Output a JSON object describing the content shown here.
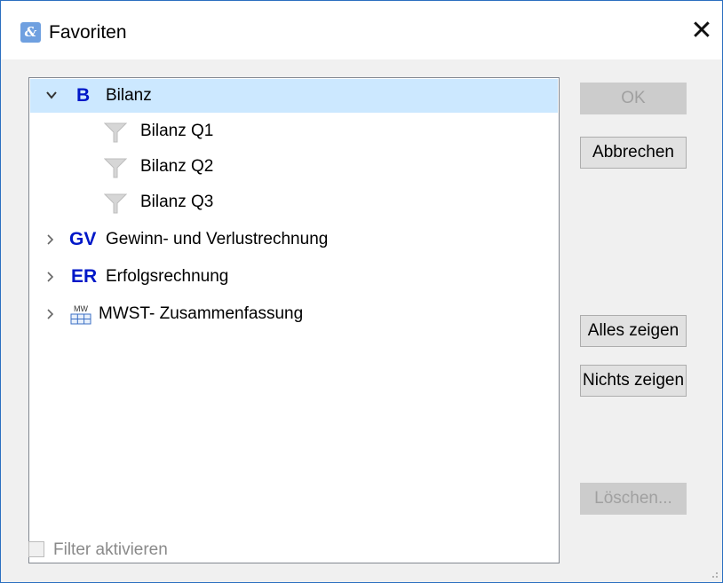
{
  "window": {
    "title": "Favoriten",
    "icon": "app-logo-icon",
    "close_glyph": "✕"
  },
  "tree": {
    "nodes": [
      {
        "abbr": "B",
        "label": "Bilanz",
        "expanded": true,
        "selected": true
      },
      {
        "label": "Bilanz Q1",
        "icon": "filter-funnel-icon"
      },
      {
        "label": "Bilanz Q2",
        "icon": "filter-funnel-icon"
      },
      {
        "label": "Bilanz Q3",
        "icon": "filter-funnel-icon"
      },
      {
        "abbr": "GV",
        "label": "Gewinn- und Verlustrechnung",
        "expanded": false
      },
      {
        "abbr": "ER",
        "label": "Erfolgsrechnung",
        "expanded": false
      },
      {
        "label": "MWST- Zusammenfassung",
        "icon": "mw-table-icon",
        "icon_text": "MW",
        "expanded": false
      }
    ],
    "collapse_glyph": "⌄",
    "expand_glyph": "›",
    "selected_color": "#cce8ff",
    "abbr_color": "#0018c8"
  },
  "buttons": {
    "ok": "OK",
    "cancel": "Abbrechen",
    "show_all": "Alles zeigen",
    "show_none": "Nichts zeigen",
    "delete": "Löschen..."
  },
  "filter": {
    "label": "Filter aktivieren",
    "checked": false,
    "enabled": false
  }
}
